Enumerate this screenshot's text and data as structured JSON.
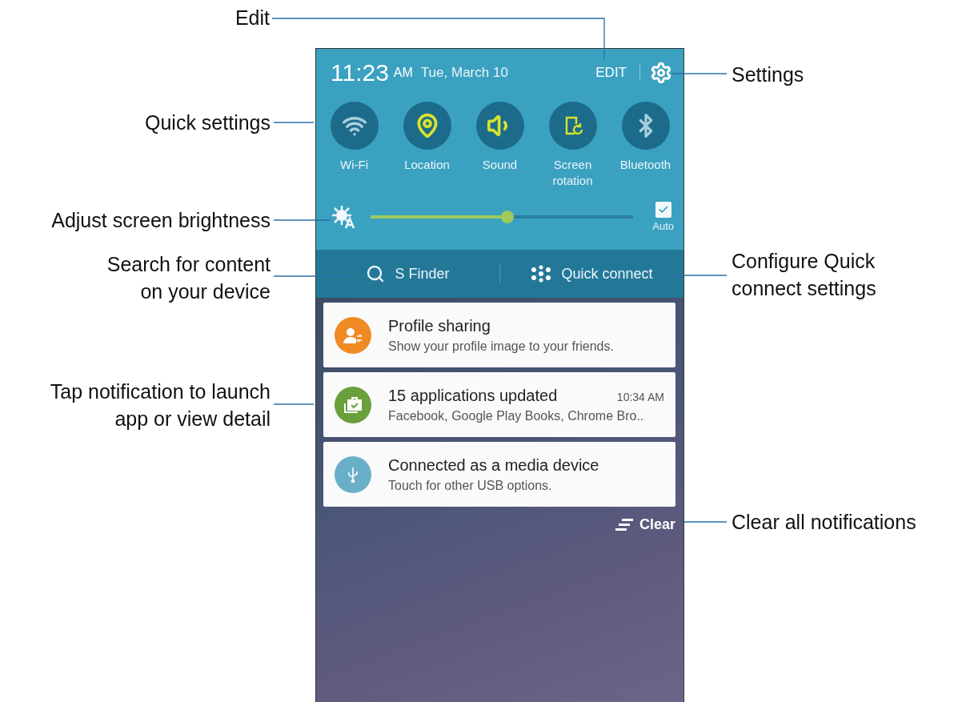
{
  "callouts": [
    {
      "text": "Edit"
    },
    {
      "text": "Settings"
    },
    {
      "text": "Quick settings"
    },
    {
      "text": "Adjust screen brightness"
    },
    {
      "text": "Search for content on your device"
    },
    {
      "text": "Configure Quick connect settings"
    },
    {
      "text": "Tap notification to launch app or view detail"
    },
    {
      "text": "Clear all notifications"
    }
  ],
  "panel": {
    "time": "11:23",
    "ampm": "AM",
    "date": "Tue, March 10",
    "edit": "EDIT",
    "toggles": [
      {
        "kind": "wifi",
        "label": "Wi-Fi",
        "on": false
      },
      {
        "kind": "location",
        "label": "Location",
        "on": true
      },
      {
        "kind": "sound",
        "label": "Sound",
        "on": true
      },
      {
        "kind": "rotation",
        "label": "Screen rotation",
        "on": true
      },
      {
        "kind": "bluetooth",
        "label": "Bluetooth",
        "on": false
      }
    ],
    "brightness": {
      "level": 0.52,
      "auto_label": "Auto",
      "auto_checked": true
    },
    "s_finder": "S Finder",
    "quick_connect": "Quick connect"
  },
  "notifications": [
    {
      "kind": "profile",
      "color": "#f08a24",
      "title": "Profile sharing",
      "text": "Show your profile image to your friends."
    },
    {
      "kind": "apps",
      "color": "#6a9f3c",
      "title": "15 applications updated",
      "time": "10:34 AM",
      "text": "Facebook, Google Play Books, Chrome Bro.."
    },
    {
      "kind": "usb",
      "color": "#6aafc8",
      "title": "Connected as a media device",
      "text": "Touch for other USB options."
    }
  ],
  "clear": "Clear"
}
